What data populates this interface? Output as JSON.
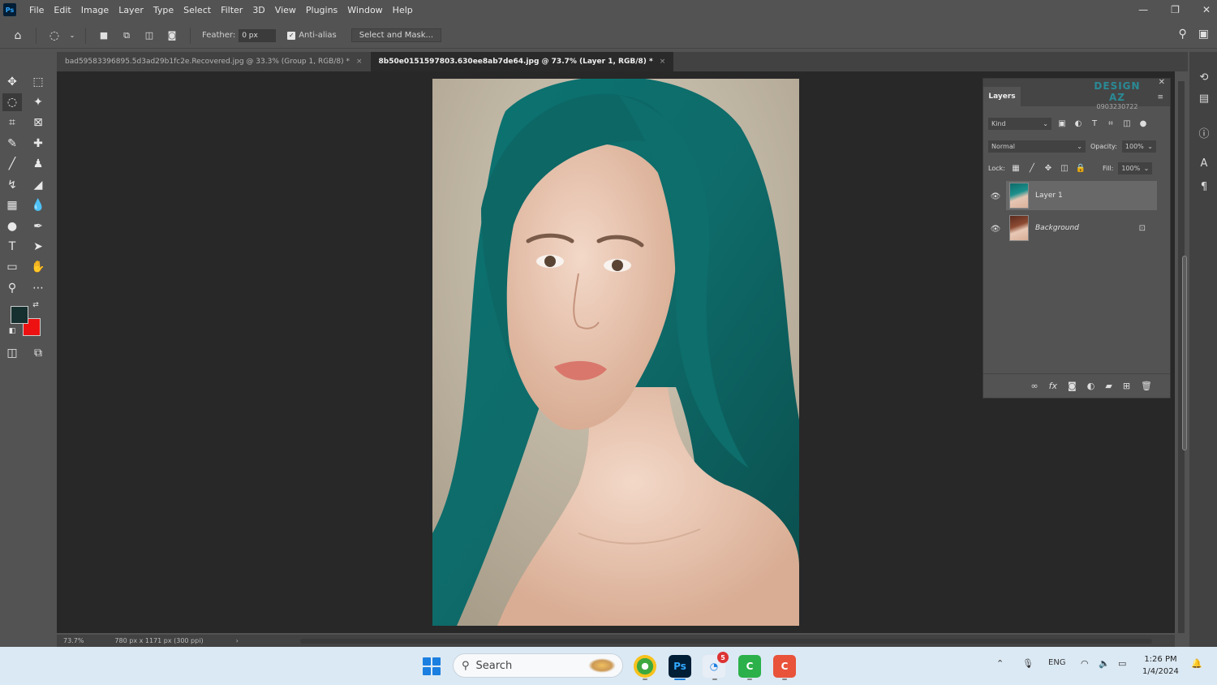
{
  "app": {
    "logo_text": "Ps"
  },
  "menu": [
    "File",
    "Edit",
    "Image",
    "Layer",
    "Type",
    "Select",
    "Filter",
    "3D",
    "View",
    "Plugins",
    "Window",
    "Help"
  ],
  "window_controls": {
    "minimize": "—",
    "restore": "❐",
    "close": "✕"
  },
  "options": {
    "feather_label": "Feather:",
    "feather_value": "0 px",
    "anti_alias_label": "Anti-alias",
    "select_mask_label": "Select and Mask..."
  },
  "tabs": [
    {
      "title": "bad59583396895.5d3ad29b1fc2e.Recovered.jpg @ 33.3% (Group 1, RGB/8) *",
      "close": "×"
    },
    {
      "title": "8b50e0151597803.630ee8ab7de64.jpg @ 73.7% (Layer 1, RGB/8) *",
      "close": "×"
    }
  ],
  "status": {
    "zoom": "73.7%",
    "doc_info": "780 px x 1171 px (300 ppi)",
    "arrow": "›"
  },
  "layers_panel": {
    "tab_label": "Layers",
    "watermark_brand": "DESIGN AZ",
    "watermark_phone": "0903230722",
    "kind_label": "Kind",
    "blend_mode": "Normal",
    "opacity_label": "Opacity:",
    "opacity_value": "100%",
    "lock_label": "Lock:",
    "fill_label": "Fill:",
    "fill_value": "100%",
    "layers": [
      {
        "name": "Layer 1"
      },
      {
        "name": "Background"
      }
    ]
  },
  "taskbar": {
    "search_placeholder": "Search",
    "ps_label": "Ps",
    "notif_badge": "5",
    "lang": "ENG",
    "time": "1:26 PM",
    "date": "1/4/2024"
  },
  "colors": {
    "foreground": "#15302f",
    "background": "#ee1111",
    "hair": "#0f6f6c",
    "accent": "#31a8ff"
  }
}
